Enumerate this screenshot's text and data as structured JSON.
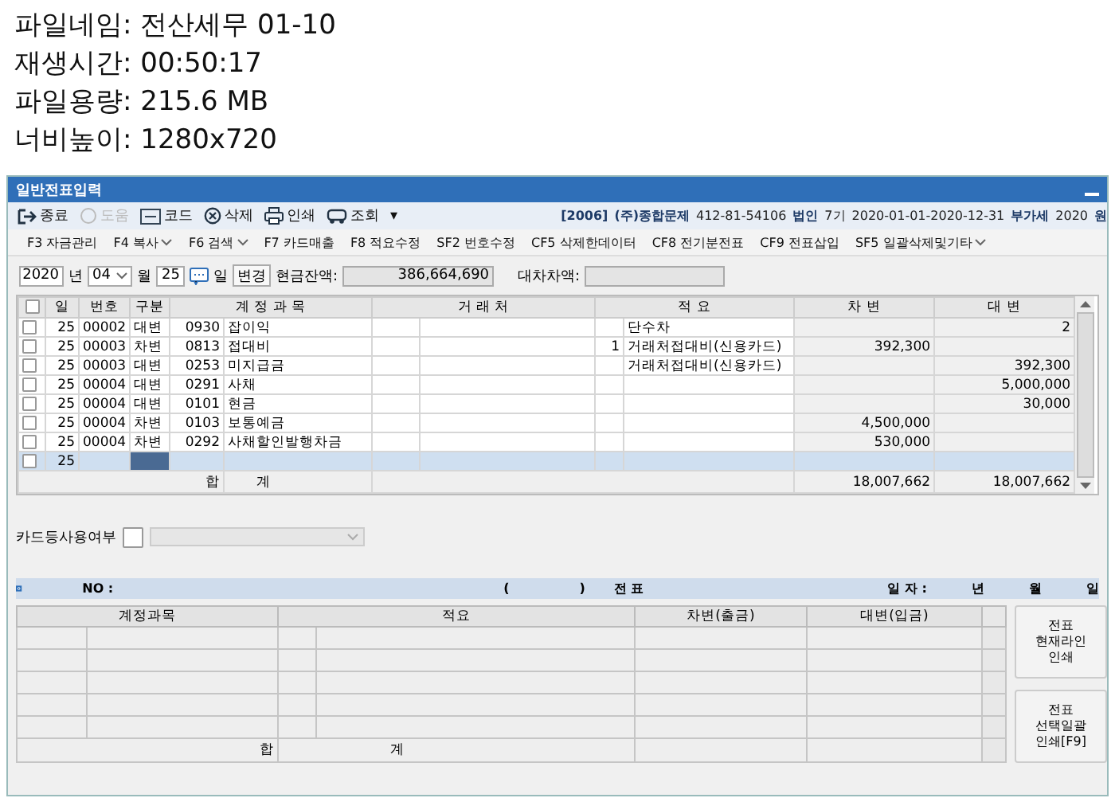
{
  "file_info": [
    {
      "label": "파일네임:",
      "value": "전산세무 01-10"
    },
    {
      "label": "재생시간:",
      "value": "00:50:17"
    },
    {
      "label": "파일용량:",
      "value": "215.6 MB"
    },
    {
      "label": "너비높이:",
      "value": "1280x720"
    }
  ],
  "window": {
    "title": "일반전표입력"
  },
  "toolbar": [
    {
      "kind": "exit",
      "label": "종료",
      "disabled": false
    },
    {
      "kind": "help",
      "label": "도움",
      "disabled": true
    },
    {
      "kind": "code",
      "label": "코드",
      "disabled": false
    },
    {
      "kind": "delete",
      "label": "삭제",
      "disabled": false
    },
    {
      "kind": "print",
      "label": "인쇄",
      "disabled": false
    },
    {
      "kind": "query",
      "label": "조회",
      "disabled": false
    },
    {
      "kind": "more",
      "label": "▾",
      "disabled": false
    }
  ],
  "company": {
    "code": "[2006]",
    "name": "(주)종합문제",
    "biz_no": "412-81-54106",
    "type": "법인",
    "term": "7기",
    "period": "2020-01-01-2020-12-31",
    "vat_label": "부가세",
    "vat_year": "2020",
    "unit": "원"
  },
  "function_keys": [
    {
      "key": "F3",
      "label": "자금관리",
      "dropdown": false
    },
    {
      "key": "F4",
      "label": "복사",
      "dropdown": true
    },
    {
      "key": "F6",
      "label": "검색",
      "dropdown": true
    },
    {
      "key": "F7",
      "label": "카드매출",
      "dropdown": false
    },
    {
      "key": "F8",
      "label": "적요수정",
      "dropdown": false
    },
    {
      "key": "SF2",
      "label": "번호수정",
      "dropdown": false
    },
    {
      "key": "CF5",
      "label": "삭제한데이터",
      "dropdown": false
    },
    {
      "key": "CF8",
      "label": "전기분전표",
      "dropdown": false
    },
    {
      "key": "CF9",
      "label": "전표삽입",
      "dropdown": false
    },
    {
      "key": "SF5",
      "label": "일괄삭제및기타",
      "dropdown": true
    }
  ],
  "date_bar": {
    "year": "2020",
    "year_unit": "년",
    "month": "04",
    "month_unit": "월",
    "day": "25",
    "day_unit": "일",
    "change_button": "변경",
    "cash_label": "현금잔액:",
    "cash_value": "386,664,690",
    "diff_label": "대차차액:"
  },
  "table": {
    "all_checked": false,
    "columns": [
      "일",
      "번호",
      "구분",
      "계 정 과 목",
      "거 래 처",
      "적 요",
      "차 변",
      "대 변"
    ],
    "rows": [
      {
        "checked": false,
        "selected": false,
        "day": "25",
        "number": "00002",
        "type": "대변",
        "account_code": "0930",
        "account_name": "잡이익",
        "memo_code": "",
        "memo": "단수차",
        "debit": "",
        "credit": "2"
      },
      {
        "checked": false,
        "selected": false,
        "day": "25",
        "number": "00003",
        "type": "차변",
        "account_code": "0813",
        "account_name": "접대비",
        "memo_code": "1",
        "memo": "거래처접대비(신용카드)",
        "debit": "392,300",
        "credit": ""
      },
      {
        "checked": false,
        "selected": false,
        "day": "25",
        "number": "00003",
        "type": "대변",
        "account_code": "0253",
        "account_name": "미지급금",
        "memo_code": "",
        "memo": "거래처접대비(신용카드)",
        "debit": "",
        "credit": "392,300"
      },
      {
        "checked": false,
        "selected": false,
        "day": "25",
        "number": "00004",
        "type": "대변",
        "account_code": "0291",
        "account_name": "사채",
        "memo_code": "",
        "memo": "",
        "debit": "",
        "credit": "5,000,000"
      },
      {
        "checked": false,
        "selected": false,
        "day": "25",
        "number": "00004",
        "type": "대변",
        "account_code": "0101",
        "account_name": "현금",
        "memo_code": "",
        "memo": "",
        "debit": "",
        "credit": "30,000"
      },
      {
        "checked": false,
        "selected": false,
        "day": "25",
        "number": "00004",
        "type": "차변",
        "account_code": "0103",
        "account_name": "보통예금",
        "memo_code": "",
        "memo": "",
        "debit": "4,500,000",
        "credit": ""
      },
      {
        "checked": false,
        "selected": false,
        "day": "25",
        "number": "00004",
        "type": "차변",
        "account_code": "0292",
        "account_name": "사채할인발행차금",
        "memo_code": "",
        "memo": "",
        "debit": "530,000",
        "credit": ""
      },
      {
        "checked": false,
        "selected": true,
        "day": "25",
        "number": "",
        "type": "",
        "account_code": "",
        "account_name": "",
        "memo_code": "",
        "memo": "",
        "debit": "",
        "credit": ""
      }
    ],
    "total": {
      "label_1": "합",
      "label_2": "계",
      "debit": "18,007,662",
      "credit": "18,007,662"
    }
  },
  "card_use": {
    "label": "카드등사용여부",
    "checked": false
  },
  "voucher_bar": {
    "no_label": "NO :",
    "paren_open": "(",
    "paren_close": ")",
    "voucher": "전 표",
    "date_label": "일 자 :",
    "year": "년",
    "month": "월",
    "day": "일"
  },
  "voucher_table": {
    "columns": [
      "계정과목",
      "적요",
      "차변(출금)",
      "대변(입금)"
    ],
    "total_1": "합",
    "total_2": "계"
  },
  "side_buttons": [
    {
      "line_1": "전표",
      "line_2": "현재라인",
      "line_3": "인쇄"
    },
    {
      "line_1": "전표",
      "line_2": "선택일괄",
      "line_3": "인쇄[F9]"
    }
  ]
}
